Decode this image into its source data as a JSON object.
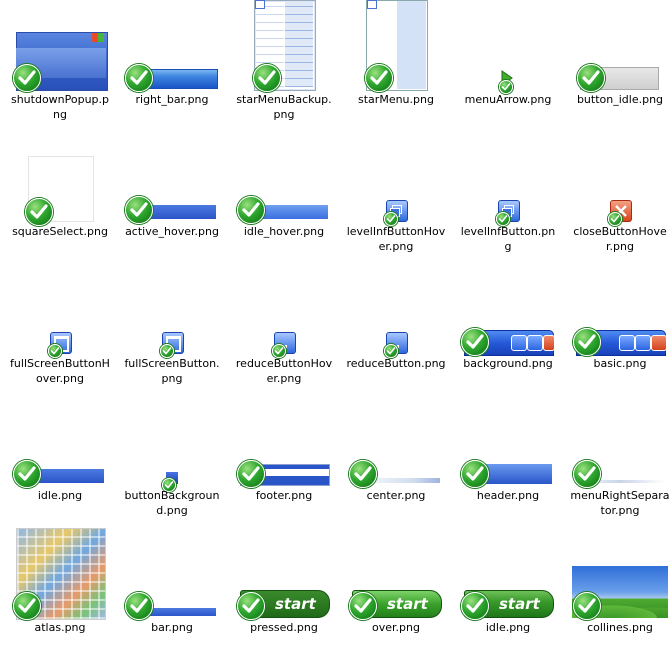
{
  "files": [
    {
      "id": "shutdownPopup",
      "label": "shutdownPopup.png"
    },
    {
      "id": "right_bar",
      "label": "right_bar.png"
    },
    {
      "id": "starMenuBackup",
      "label": "starMenuBackup.png"
    },
    {
      "id": "starMenu",
      "label": "starMenu.png"
    },
    {
      "id": "menuArrow",
      "label": "menuArrow.png"
    },
    {
      "id": "button_idle",
      "label": "button_idle.png"
    },
    {
      "id": "squareSelect",
      "label": "squareSelect.png"
    },
    {
      "id": "active_hover",
      "label": "active_hover.png"
    },
    {
      "id": "idle_hover",
      "label": "idle_hover.png"
    },
    {
      "id": "levelInfButtonHover",
      "label": "levelInfButtonHover.png"
    },
    {
      "id": "levelInfButton",
      "label": "levelInfButton.png"
    },
    {
      "id": "closeButtonHover",
      "label": "closeButtonHover.png"
    },
    {
      "id": "fullScreenButtonHover",
      "label": "fullScreenButtonHover.png"
    },
    {
      "id": "fullScreenButton",
      "label": "fullScreenButton.png"
    },
    {
      "id": "reduceButtonHover",
      "label": "reduceButtonHover.png"
    },
    {
      "id": "reduceButton",
      "label": "reduceButton.png"
    },
    {
      "id": "background",
      "label": "background.png"
    },
    {
      "id": "basic",
      "label": "basic.png"
    },
    {
      "id": "idle",
      "label": "idle.png"
    },
    {
      "id": "buttonBackground",
      "label": "buttonBackground.png"
    },
    {
      "id": "footer",
      "label": "footer.png"
    },
    {
      "id": "center",
      "label": "center.png"
    },
    {
      "id": "header",
      "label": "header.png"
    },
    {
      "id": "menuRightSeparator",
      "label": "menuRightSeparator.png"
    },
    {
      "id": "atlas",
      "label": "atlas.png"
    },
    {
      "id": "bar",
      "label": "bar.png"
    },
    {
      "id": "pressed",
      "label": "pressed.png"
    },
    {
      "id": "over",
      "label": "over.png"
    },
    {
      "id": "idle2",
      "label": "idle.png"
    },
    {
      "id": "collines",
      "label": "collines.png"
    }
  ],
  "start_text": "start",
  "colors": {
    "check": "#2fa82f",
    "xp_blue": "#2659d8",
    "start_green": "#3a9a2c"
  }
}
